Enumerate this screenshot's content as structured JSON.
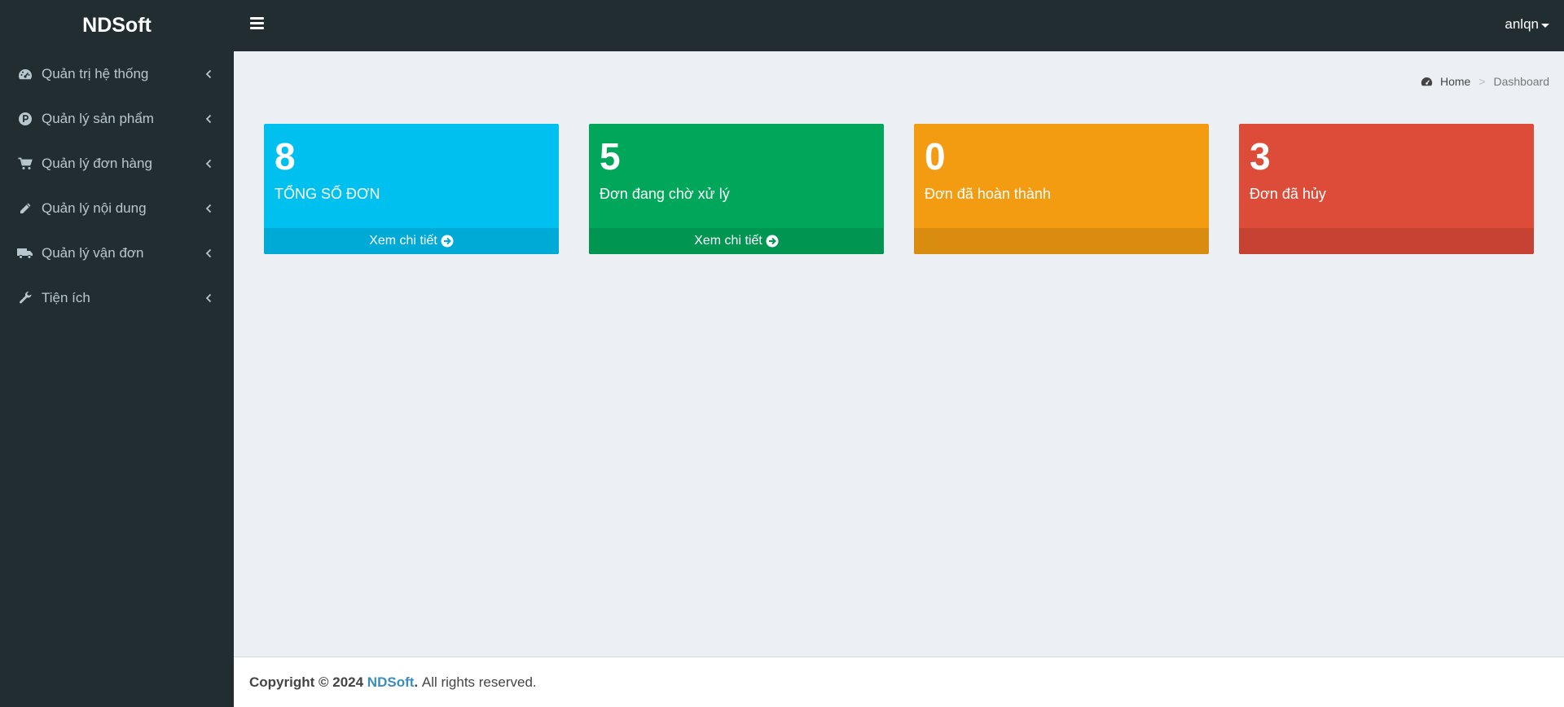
{
  "app": {
    "logo": "NDSoft"
  },
  "sidebar": {
    "items": [
      {
        "label": "Quản trị hệ thống",
        "icon": "dashboard-gauge-icon"
      },
      {
        "label": "Quản lý sản phẩm",
        "icon": "product-p-circle-icon"
      },
      {
        "label": "Quản lý đơn hàng",
        "icon": "shopping-cart-icon"
      },
      {
        "label": "Quản lý nội dung",
        "icon": "pencil-icon"
      },
      {
        "label": "Quản lý vận đơn",
        "icon": "truck-icon"
      },
      {
        "label": "Tiện ích",
        "icon": "wrench-icon"
      }
    ]
  },
  "header": {
    "user": "anlqn"
  },
  "breadcrumb": {
    "home": "Home",
    "separator": ">",
    "current": "Dashboard"
  },
  "boxes": [
    {
      "number": "8",
      "label": "TỔNG SỐ ĐƠN",
      "link": "Xem chi tiết",
      "color": "#00c0ef",
      "footer_color": "#00aad6"
    },
    {
      "number": "5",
      "label": "Đơn đang chờ xử lý",
      "link": "Xem chi tiết",
      "color": "#00a65a",
      "footer_color": "#009551"
    },
    {
      "number": "0",
      "label": "Đơn đã hoàn thành",
      "link": "",
      "color": "#f39c12",
      "footer_color": "#da8c10"
    },
    {
      "number": "3",
      "label": "Đơn đã hủy",
      "link": "",
      "color": "#dd4b39",
      "footer_color": "#c64333"
    }
  ],
  "footer": {
    "prefix": "Copyright © 2024",
    "brand": "NDSoft",
    "suffix": ". All rights reserved."
  }
}
